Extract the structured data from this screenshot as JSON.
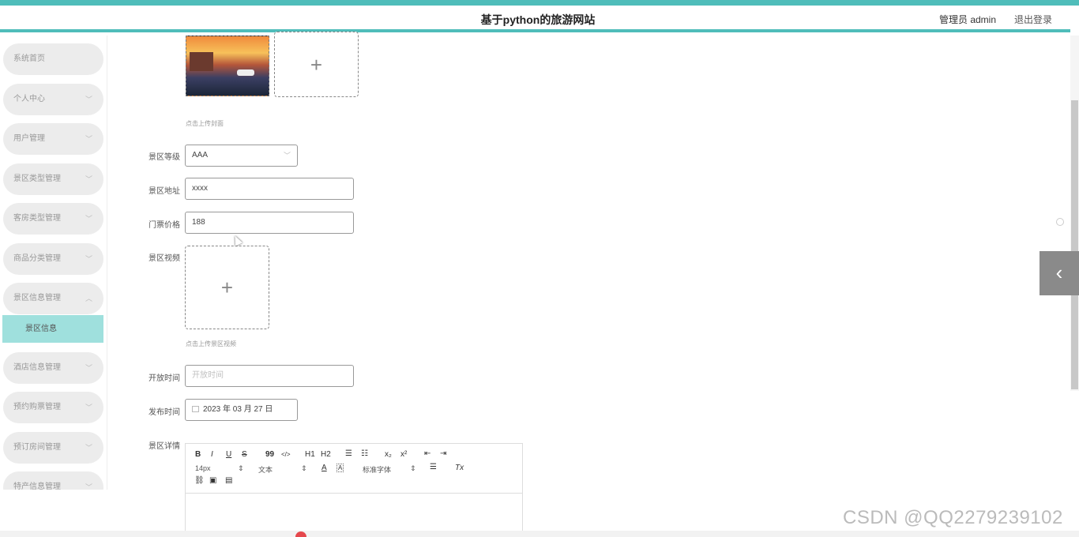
{
  "header": {
    "title": "基于python的旅游网站",
    "user": "管理员 admin",
    "logout": "退出登录"
  },
  "sidebar": {
    "items": [
      {
        "label": "系统首页"
      },
      {
        "label": "个人中心"
      },
      {
        "label": "用户管理"
      },
      {
        "label": "景区类型管理"
      },
      {
        "label": "客房类型管理"
      },
      {
        "label": "商品分类管理"
      },
      {
        "label": "景区信息管理"
      },
      {
        "label": "景区信息"
      },
      {
        "label": "酒店信息管理"
      },
      {
        "label": "预约购票管理"
      },
      {
        "label": "预订房间管理"
      },
      {
        "label": "特产信息管理"
      }
    ]
  },
  "form": {
    "cover_hint": "点击上传封面",
    "level": {
      "label": "景区等级",
      "value": "AAA"
    },
    "address": {
      "label": "景区地址",
      "value": "xxxx"
    },
    "price": {
      "label": "门票价格",
      "value": "188"
    },
    "video": {
      "label": "景区视频",
      "hint": "点击上传景区视频"
    },
    "open_time": {
      "label": "开放时间",
      "placeholder": "开放时间"
    },
    "publish_time": {
      "label": "发布时间",
      "value": "2023 年 03 月 27 日"
    },
    "detail": {
      "label": "景区详情"
    }
  },
  "editor": {
    "row1": [
      "B",
      "I",
      "U",
      "S",
      "99",
      "</>",
      "H1",
      "H2",
      "☰",
      "☷",
      "x₂",
      "x²",
      "⇤",
      "⇥"
    ],
    "font_size": "14px",
    "text_style": "文本",
    "font_family": "标准字体",
    "clear": "Tx"
  },
  "watermark": "CSDN @QQ2279239102",
  "icons": [
    "plus-icon",
    "chevron-down-icon",
    "chevron-up-icon",
    "calendar-icon",
    "chevron-left-icon"
  ]
}
